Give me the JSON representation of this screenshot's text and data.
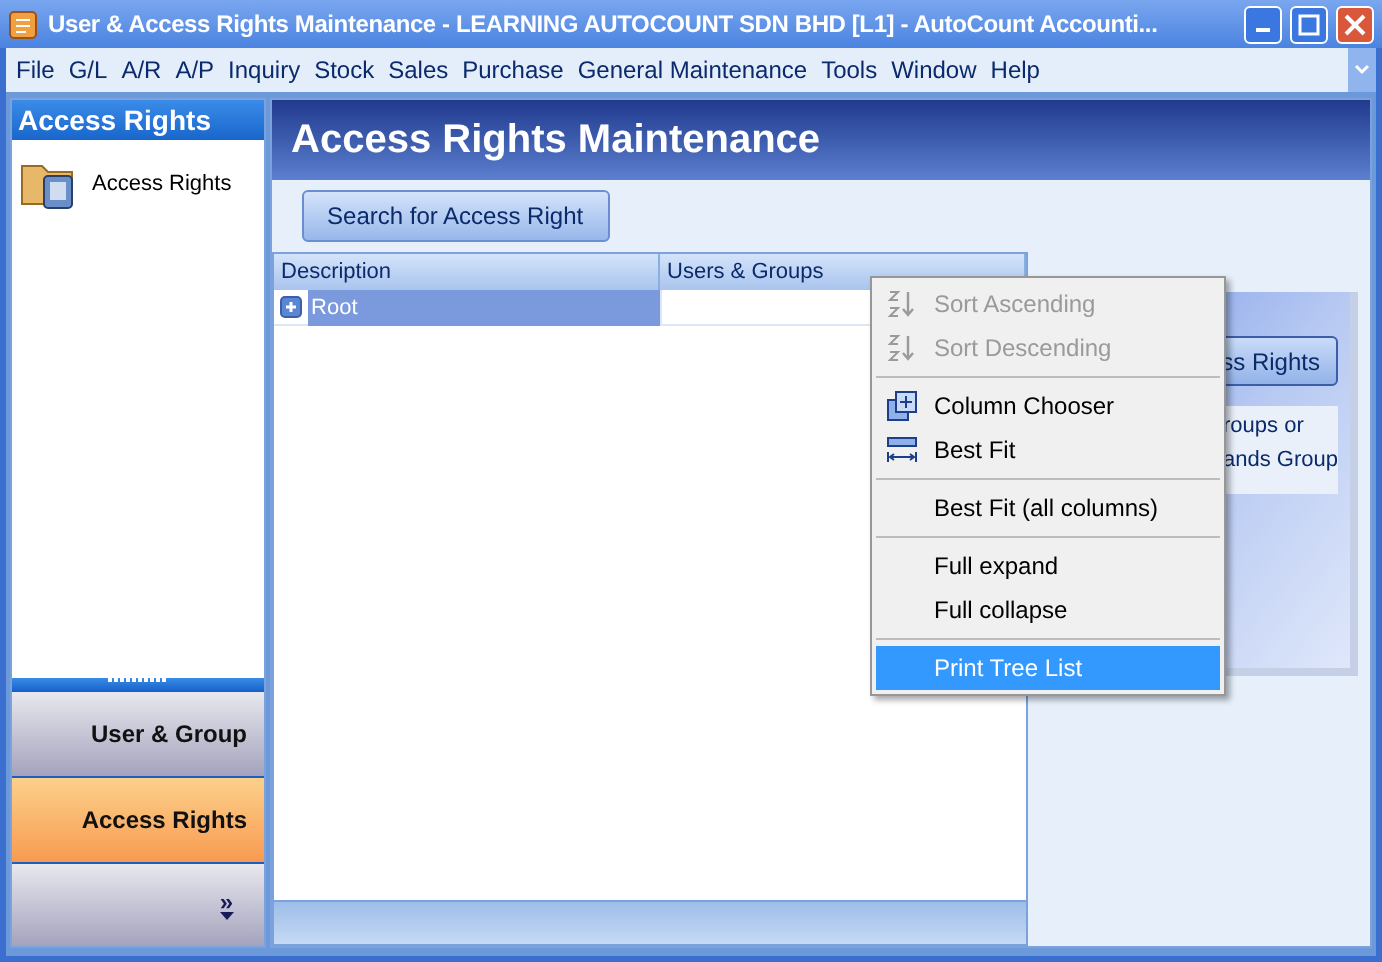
{
  "window": {
    "title": "User & Access Rights Maintenance - LEARNING AUTOCOUNT SDN BHD [L1] - AutoCount Accounti..."
  },
  "menu_bar": [
    "File",
    "G/L",
    "A/R",
    "A/P",
    "Inquiry",
    "Stock",
    "Sales",
    "Purchase",
    "General Maintenance",
    "Tools",
    "Window",
    "Help"
  ],
  "sidebar": {
    "header": "Access Rights",
    "items": [
      {
        "label": "Access Rights"
      }
    ],
    "nav_buttons": [
      {
        "label": "User & Group",
        "selected": false
      },
      {
        "label": "Access Rights",
        "selected": true
      }
    ],
    "more": "»"
  },
  "page": {
    "title": "Access Rights Maintenance",
    "search_button": "Search for Access Right",
    "tree": {
      "columns": [
        "Description",
        "Users & Groups"
      ],
      "rows": [
        {
          "description": "Root",
          "expanded": false,
          "selected": true
        }
      ]
    },
    "side_card": {
      "button": "ss Rights",
      "lines": [
        "roups or",
        "ands Group"
      ]
    }
  },
  "context_menu": {
    "groups": [
      [
        {
          "label": "Sort Ascending",
          "kind": "sort-asc",
          "disabled": true,
          "selected": false
        },
        {
          "label": "Sort Descending",
          "kind": "sort-desc",
          "disabled": true,
          "selected": false
        }
      ],
      [
        {
          "label": "Column Chooser",
          "kind": "columns",
          "disabled": false,
          "selected": false
        },
        {
          "label": "Best Fit",
          "kind": "best-fit",
          "disabled": false,
          "selected": false
        }
      ],
      [
        {
          "label": "Best Fit (all columns)",
          "kind": "plain",
          "disabled": false,
          "selected": false
        }
      ],
      [
        {
          "label": "Full expand",
          "kind": "plain",
          "disabled": false,
          "selected": false
        },
        {
          "label": "Full collapse",
          "kind": "plain",
          "disabled": false,
          "selected": false
        }
      ],
      [
        {
          "label": "Print Tree List",
          "kind": "plain",
          "disabled": false,
          "selected": true
        }
      ]
    ]
  }
}
